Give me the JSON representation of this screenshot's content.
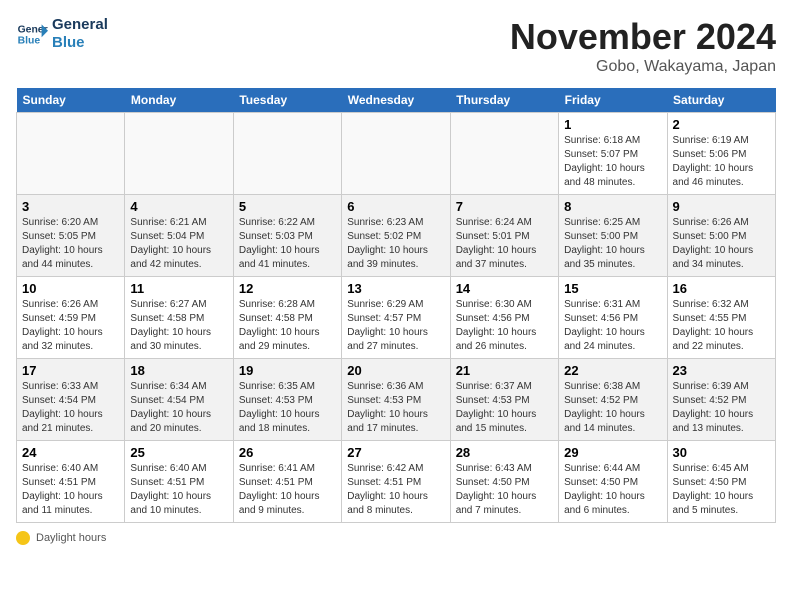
{
  "header": {
    "logo_line1": "General",
    "logo_line2": "Blue",
    "title": "November 2024",
    "subtitle": "Gobo, Wakayama, Japan"
  },
  "days_of_week": [
    "Sunday",
    "Monday",
    "Tuesday",
    "Wednesday",
    "Thursday",
    "Friday",
    "Saturday"
  ],
  "legend": {
    "label": "Daylight hours"
  },
  "weeks": [
    [
      {
        "day": "",
        "info": ""
      },
      {
        "day": "",
        "info": ""
      },
      {
        "day": "",
        "info": ""
      },
      {
        "day": "",
        "info": ""
      },
      {
        "day": "",
        "info": ""
      },
      {
        "day": "1",
        "info": "Sunrise: 6:18 AM\nSunset: 5:07 PM\nDaylight: 10 hours\nand 48 minutes."
      },
      {
        "day": "2",
        "info": "Sunrise: 6:19 AM\nSunset: 5:06 PM\nDaylight: 10 hours\nand 46 minutes."
      }
    ],
    [
      {
        "day": "3",
        "info": "Sunrise: 6:20 AM\nSunset: 5:05 PM\nDaylight: 10 hours\nand 44 minutes."
      },
      {
        "day": "4",
        "info": "Sunrise: 6:21 AM\nSunset: 5:04 PM\nDaylight: 10 hours\nand 42 minutes."
      },
      {
        "day": "5",
        "info": "Sunrise: 6:22 AM\nSunset: 5:03 PM\nDaylight: 10 hours\nand 41 minutes."
      },
      {
        "day": "6",
        "info": "Sunrise: 6:23 AM\nSunset: 5:02 PM\nDaylight: 10 hours\nand 39 minutes."
      },
      {
        "day": "7",
        "info": "Sunrise: 6:24 AM\nSunset: 5:01 PM\nDaylight: 10 hours\nand 37 minutes."
      },
      {
        "day": "8",
        "info": "Sunrise: 6:25 AM\nSunset: 5:00 PM\nDaylight: 10 hours\nand 35 minutes."
      },
      {
        "day": "9",
        "info": "Sunrise: 6:26 AM\nSunset: 5:00 PM\nDaylight: 10 hours\nand 34 minutes."
      }
    ],
    [
      {
        "day": "10",
        "info": "Sunrise: 6:26 AM\nSunset: 4:59 PM\nDaylight: 10 hours\nand 32 minutes."
      },
      {
        "day": "11",
        "info": "Sunrise: 6:27 AM\nSunset: 4:58 PM\nDaylight: 10 hours\nand 30 minutes."
      },
      {
        "day": "12",
        "info": "Sunrise: 6:28 AM\nSunset: 4:58 PM\nDaylight: 10 hours\nand 29 minutes."
      },
      {
        "day": "13",
        "info": "Sunrise: 6:29 AM\nSunset: 4:57 PM\nDaylight: 10 hours\nand 27 minutes."
      },
      {
        "day": "14",
        "info": "Sunrise: 6:30 AM\nSunset: 4:56 PM\nDaylight: 10 hours\nand 26 minutes."
      },
      {
        "day": "15",
        "info": "Sunrise: 6:31 AM\nSunset: 4:56 PM\nDaylight: 10 hours\nand 24 minutes."
      },
      {
        "day": "16",
        "info": "Sunrise: 6:32 AM\nSunset: 4:55 PM\nDaylight: 10 hours\nand 22 minutes."
      }
    ],
    [
      {
        "day": "17",
        "info": "Sunrise: 6:33 AM\nSunset: 4:54 PM\nDaylight: 10 hours\nand 21 minutes."
      },
      {
        "day": "18",
        "info": "Sunrise: 6:34 AM\nSunset: 4:54 PM\nDaylight: 10 hours\nand 20 minutes."
      },
      {
        "day": "19",
        "info": "Sunrise: 6:35 AM\nSunset: 4:53 PM\nDaylight: 10 hours\nand 18 minutes."
      },
      {
        "day": "20",
        "info": "Sunrise: 6:36 AM\nSunset: 4:53 PM\nDaylight: 10 hours\nand 17 minutes."
      },
      {
        "day": "21",
        "info": "Sunrise: 6:37 AM\nSunset: 4:53 PM\nDaylight: 10 hours\nand 15 minutes."
      },
      {
        "day": "22",
        "info": "Sunrise: 6:38 AM\nSunset: 4:52 PM\nDaylight: 10 hours\nand 14 minutes."
      },
      {
        "day": "23",
        "info": "Sunrise: 6:39 AM\nSunset: 4:52 PM\nDaylight: 10 hours\nand 13 minutes."
      }
    ],
    [
      {
        "day": "24",
        "info": "Sunrise: 6:40 AM\nSunset: 4:51 PM\nDaylight: 10 hours\nand 11 minutes."
      },
      {
        "day": "25",
        "info": "Sunrise: 6:40 AM\nSunset: 4:51 PM\nDaylight: 10 hours\nand 10 minutes."
      },
      {
        "day": "26",
        "info": "Sunrise: 6:41 AM\nSunset: 4:51 PM\nDaylight: 10 hours\nand 9 minutes."
      },
      {
        "day": "27",
        "info": "Sunrise: 6:42 AM\nSunset: 4:51 PM\nDaylight: 10 hours\nand 8 minutes."
      },
      {
        "day": "28",
        "info": "Sunrise: 6:43 AM\nSunset: 4:50 PM\nDaylight: 10 hours\nand 7 minutes."
      },
      {
        "day": "29",
        "info": "Sunrise: 6:44 AM\nSunset: 4:50 PM\nDaylight: 10 hours\nand 6 minutes."
      },
      {
        "day": "30",
        "info": "Sunrise: 6:45 AM\nSunset: 4:50 PM\nDaylight: 10 hours\nand 5 minutes."
      }
    ]
  ]
}
